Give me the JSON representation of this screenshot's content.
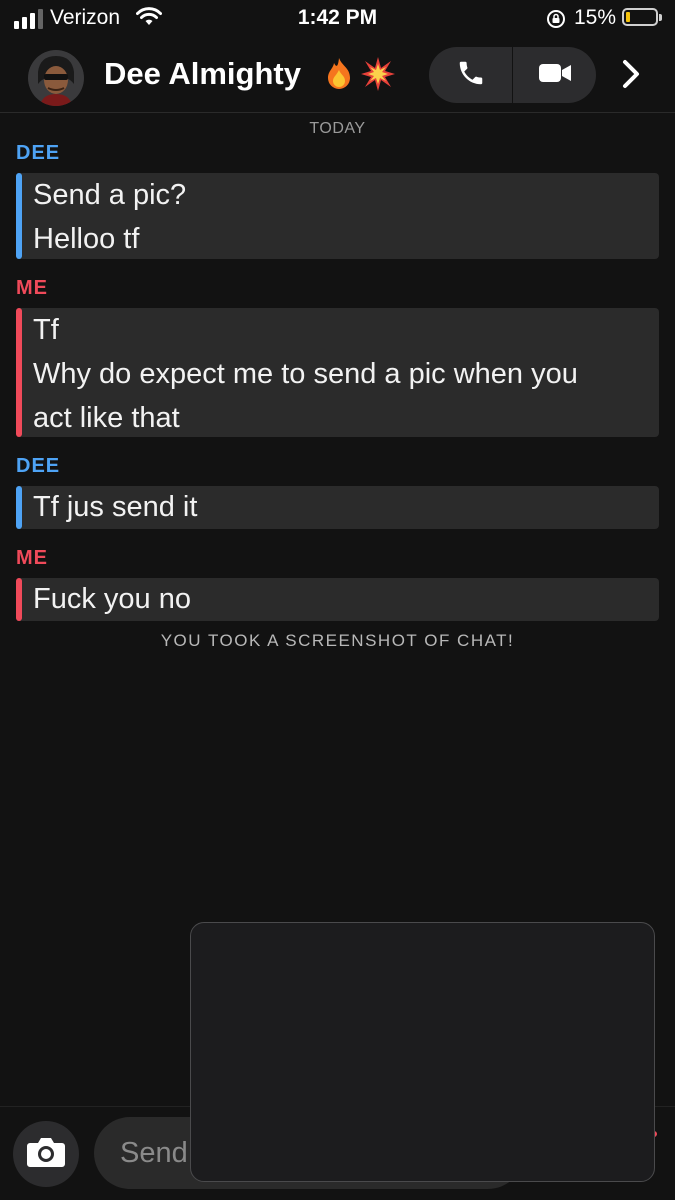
{
  "status_bar": {
    "carrier": "Verizon",
    "time": "1:42 PM",
    "battery_percent": "15%",
    "battery_level": 0.15,
    "battery_color": "#f4c20d",
    "icons": [
      "signal-icon",
      "wifi-icon",
      "rotation-lock-icon",
      "battery-icon"
    ]
  },
  "header": {
    "contact_name": "Dee Almighty",
    "name_emojis": [
      "🔥",
      "💥"
    ],
    "icons": [
      "phone-icon",
      "video-camera-icon",
      "chevron-right-icon"
    ]
  },
  "chat": {
    "date_label": "TODAY",
    "colors": {
      "dee": "#4ea3f5",
      "me": "#f04a5a"
    },
    "messages": [
      {
        "sender": "DEE",
        "lines": [
          "Send a pic?",
          "Helloo tf"
        ]
      },
      {
        "sender": "ME",
        "lines": [
          "Tf",
          "Why do expect me to send a pic when you",
          "act like that"
        ]
      },
      {
        "sender": "DEE",
        "lines": [
          "Tf jus send it"
        ]
      },
      {
        "sender": "ME",
        "lines": [
          "Fuck you no"
        ]
      }
    ],
    "system_note": "YOU TOOK A SCREENSHOT OF CHAT!"
  },
  "composer": {
    "placeholder": "Send a Chat",
    "icons": [
      "camera-icon"
    ]
  }
}
